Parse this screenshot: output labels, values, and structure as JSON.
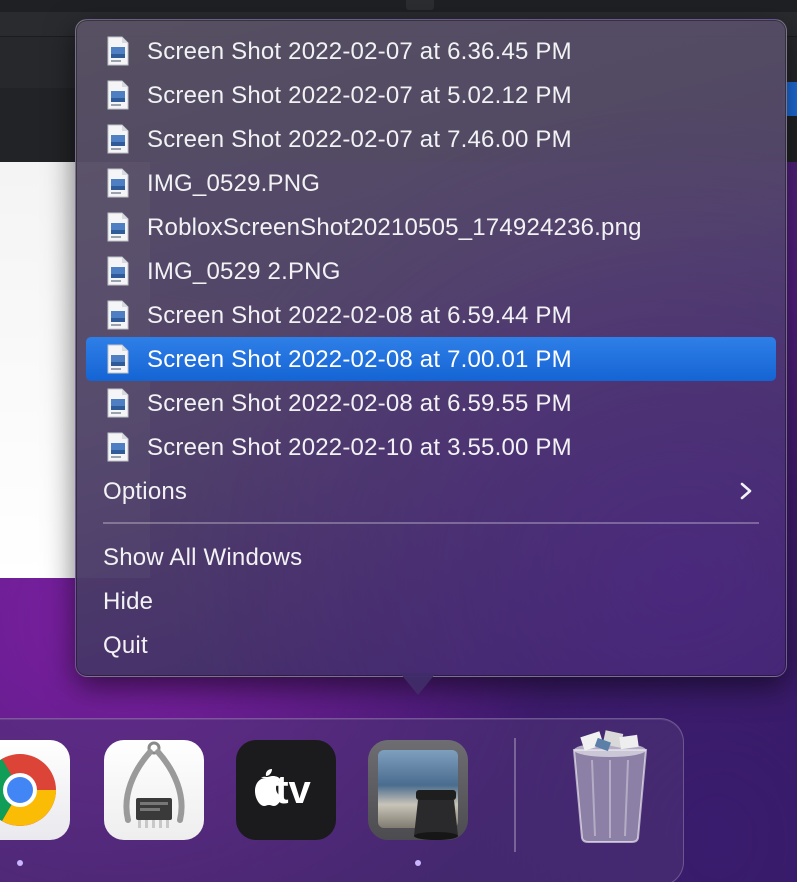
{
  "menu": {
    "recent_files": [
      {
        "label": "Screen Shot 2022-02-07 at 6.36.45 PM",
        "icon": "image-file-icon",
        "selected": false
      },
      {
        "label": "Screen Shot 2022-02-07 at 5.02.12 PM",
        "icon": "image-file-icon",
        "selected": false
      },
      {
        "label": "Screen Shot 2022-02-07 at 7.46.00 PM",
        "icon": "image-file-icon",
        "selected": false
      },
      {
        "label": "IMG_0529.PNG",
        "icon": "image-file-icon",
        "selected": false
      },
      {
        "label": "RobloxScreenShot20210505_174924236.png",
        "icon": "image-file-icon",
        "selected": false
      },
      {
        "label": "IMG_0529 2.PNG",
        "icon": "image-file-icon",
        "selected": false
      },
      {
        "label": "Screen Shot 2022-02-08 at 6.59.44 PM",
        "icon": "image-file-icon",
        "selected": false
      },
      {
        "label": "Screen Shot 2022-02-08 at 7.00.01 PM",
        "icon": "image-file-icon",
        "selected": true
      },
      {
        "label": "Screen Shot 2022-02-08 at 6.59.55 PM",
        "icon": "image-file-icon",
        "selected": false
      },
      {
        "label": "Screen Shot 2022-02-10 at 3.55.00 PM",
        "icon": "image-file-icon",
        "selected": false
      }
    ],
    "options_label": "Options",
    "show_all_windows_label": "Show All Windows",
    "hide_label": "Hide",
    "quit_label": "Quit"
  },
  "dock": {
    "apps": [
      {
        "name": "Google Chrome",
        "icon": "chrome-icon",
        "running": true
      },
      {
        "name": "System Information",
        "icon": "system-information-icon",
        "running": false
      },
      {
        "name": "Apple TV",
        "icon": "apple-tv-icon",
        "running": false,
        "tile_text": "tv"
      },
      {
        "name": "Preview",
        "icon": "preview-icon",
        "running": true
      },
      {
        "name": "Trash",
        "icon": "trash-icon",
        "running": false
      }
    ]
  },
  "colors": {
    "selection": "#1f6fe0",
    "menu_text": "#f2f2f4",
    "accent_blue": "#1e6fe0",
    "wallpaper_purple": "#5a1e86"
  }
}
